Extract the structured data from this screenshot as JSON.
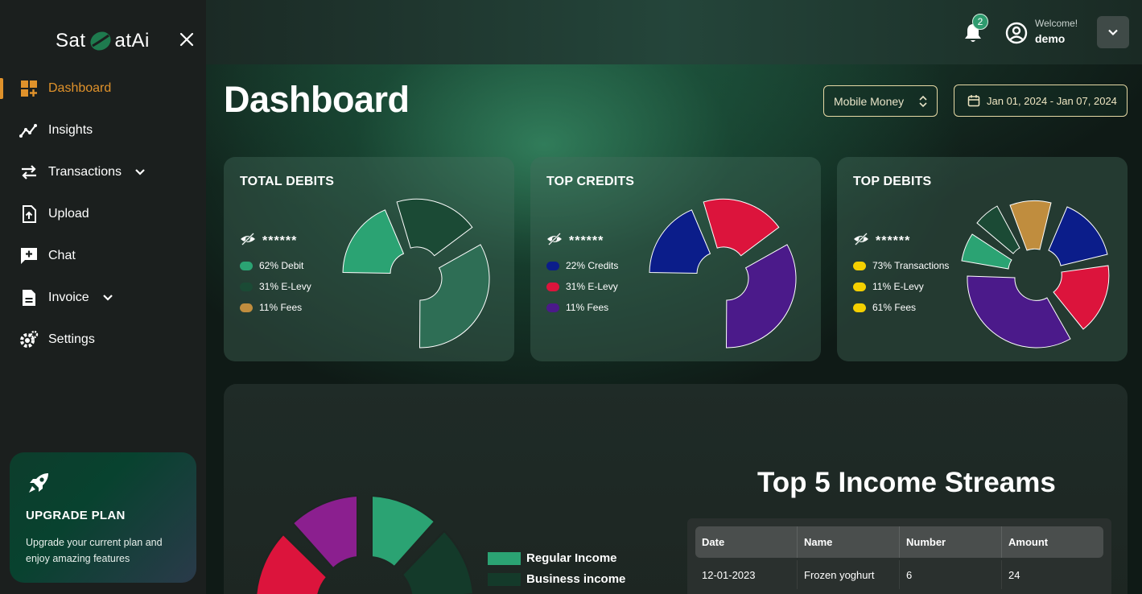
{
  "app": {
    "logo_left": "Sat",
    "logo_right": "atAi"
  },
  "sidebar": {
    "items": [
      {
        "label": "Dashboard"
      },
      {
        "label": "Insights"
      },
      {
        "label": "Transactions"
      },
      {
        "label": "Upload"
      },
      {
        "label": "Chat"
      },
      {
        "label": "Invoice"
      },
      {
        "label": "Settings"
      }
    ],
    "upgrade": {
      "title": "UPGRADE PLAN",
      "description": "Upgrade your current plan and enjoy amazing features"
    }
  },
  "header": {
    "notifications_count": "2",
    "welcome": "Welcome!",
    "username": "demo"
  },
  "page": {
    "title": "Dashboard",
    "account_select": "Mobile Money",
    "date_range": "Jan 01, 2024 - Jan 07, 2024"
  },
  "cards": [
    {
      "title": "TOTAL DEBITS",
      "masked": "******",
      "legend": [
        {
          "label": "62% Debit",
          "color": "#2ba373"
        },
        {
          "label": "31% E-Levy",
          "color": "#1b4a35"
        },
        {
          "label": "11% Fees",
          "color": "#c08d3e"
        }
      ]
    },
    {
      "title": "TOP CREDITS",
      "masked": "******",
      "legend": [
        {
          "label": "22% Credits",
          "color": "#0b1d8a"
        },
        {
          "label": "31% E-Levy",
          "color": "#dc143c"
        },
        {
          "label": "11% Fees",
          "color": "#4b1a8a"
        }
      ]
    },
    {
      "title": "TOP DEBITS",
      "masked": "******",
      "legend": [
        {
          "label": "73% Transactions",
          "color": "#f5d000"
        },
        {
          "label": "11% E-Levy",
          "color": "#f5d000"
        },
        {
          "label": "61% Fees",
          "color": "#f5d000"
        }
      ]
    }
  ],
  "income": {
    "title": "Top 5 Income Streams",
    "legend": [
      {
        "label": "Regular Income",
        "color": "#2ba373"
      },
      {
        "label": "Business income",
        "color": "#143a2a"
      }
    ],
    "columns": [
      "Date",
      "Name",
      "Number",
      "Amount"
    ],
    "rows": [
      [
        "12-01-2023",
        "Frozen yoghurt",
        "6",
        "24"
      ]
    ]
  }
}
